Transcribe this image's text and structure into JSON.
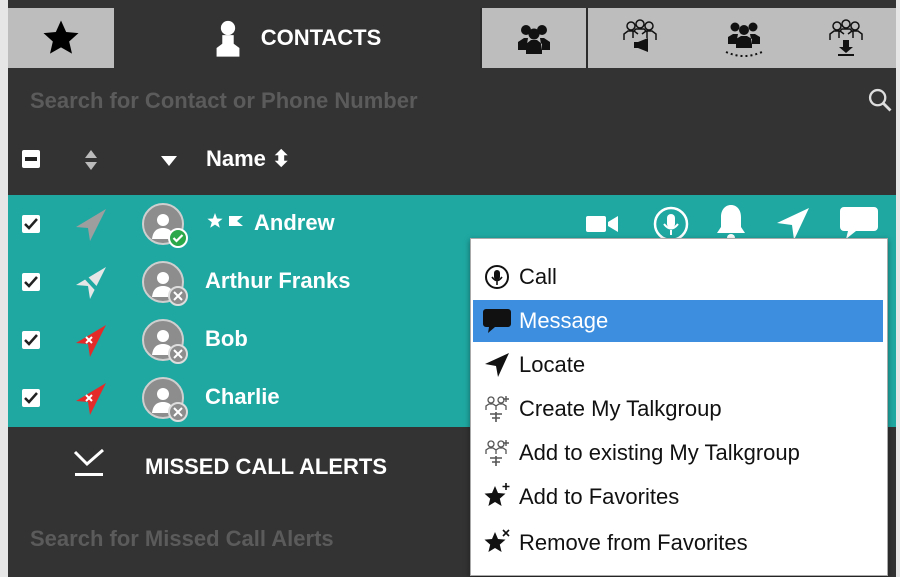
{
  "tabs": [
    {
      "icon": "star-icon"
    },
    {
      "icon": "contact-person-icon",
      "label": "CONTACTS",
      "active": true
    },
    {
      "icon": "group-icon"
    },
    {
      "icon": "broadcast-group-icon"
    },
    {
      "icon": "dispatch-group-icon"
    },
    {
      "icon": "download-group-icon"
    }
  ],
  "contacts_search": {
    "placeholder": "Search for Contact or Phone Number"
  },
  "table_header": {
    "name_label": "Name ⬍"
  },
  "contacts": [
    {
      "name": "Andrew",
      "checked": true,
      "favorite": true,
      "status": "online",
      "location_color": "#9e9e9e"
    },
    {
      "name": "Arthur Franks",
      "checked": true,
      "favorite": false,
      "status": "offline",
      "location_color": "#e6e6e6"
    },
    {
      "name": "Bob",
      "checked": true,
      "favorite": false,
      "status": "offline",
      "location_color": "#e52a2a"
    },
    {
      "name": "Charlie",
      "checked": true,
      "favorite": false,
      "status": "offline",
      "location_color": "#e52a2a"
    }
  ],
  "missed_calls": {
    "title": "MISSED CALL ALERTS",
    "search_placeholder": "Search for Missed Call Alerts"
  },
  "context_menu": [
    {
      "label": "Call",
      "icon": "ptt-call-icon",
      "highlighted": false
    },
    {
      "label": "Message",
      "icon": "message-bubble-icon",
      "highlighted": true
    },
    {
      "label": "Locate",
      "icon": "locate-arrow-icon",
      "highlighted": false
    },
    {
      "label": "Create My Talkgroup",
      "icon": "create-talkgroup-icon",
      "highlighted": false
    },
    {
      "label": "Add to existing My Talkgroup",
      "icon": "add-talkgroup-icon",
      "highlighted": false
    },
    {
      "label": "Add to Favorites",
      "icon": "add-favorite-icon",
      "highlighted": false
    },
    {
      "label": "Remove from Favorites",
      "icon": "remove-favorite-icon",
      "highlighted": false
    }
  ],
  "colors": {
    "accent": "#1fa8a2",
    "menu_highlight": "#3d8edf",
    "panel_dark": "#333333",
    "online": "#2aa84a",
    "offline": "#8d8d8d"
  }
}
